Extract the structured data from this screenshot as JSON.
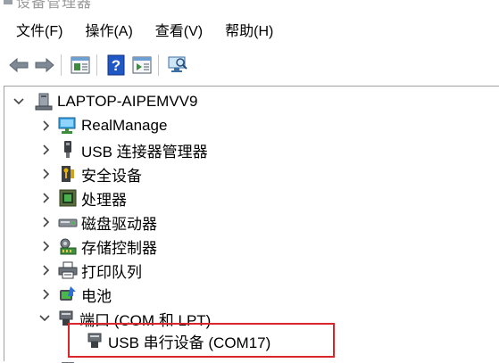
{
  "window": {
    "title": "设备管理器"
  },
  "menu": [
    {
      "label": "文件(F)"
    },
    {
      "label": "操作(A)"
    },
    {
      "label": "查看(V)"
    },
    {
      "label": "帮助(H)"
    }
  ],
  "toolbar": {
    "buttons": [
      "back-arrow-icon",
      "forward-arrow-icon",
      "properties-icon",
      "help-icon",
      "run-icon",
      "scan-hardware-icon"
    ]
  },
  "tree": {
    "root": {
      "label": "LAPTOP-AIPEMVV9",
      "expanded": true
    },
    "items": [
      {
        "label": "RealManage",
        "icon": "monitor-network-icon"
      },
      {
        "label": "USB 连接器管理器",
        "icon": "usb-connector-icon"
      },
      {
        "label": "安全设备",
        "icon": "security-device-icon"
      },
      {
        "label": "处理器",
        "icon": "processor-icon"
      },
      {
        "label": "磁盘驱动器",
        "icon": "disk-drive-icon"
      },
      {
        "label": "存储控制器",
        "icon": "storage-controller-icon"
      },
      {
        "label": "打印队列",
        "icon": "printer-icon"
      },
      {
        "label": "电池",
        "icon": "battery-icon"
      },
      {
        "label": "端口 (COM 和 LPT)",
        "icon": "port-icon",
        "expanded": true
      }
    ],
    "child": {
      "label": "USB 串行设备 (COM17)",
      "icon": "usb-serial-icon"
    }
  },
  "colors": {
    "highlight": "#d9262b",
    "chevron": "#444444"
  }
}
